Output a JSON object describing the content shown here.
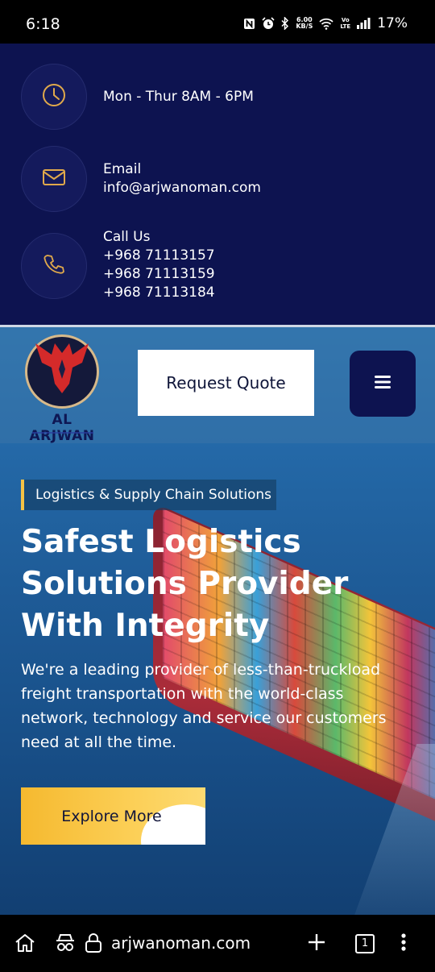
{
  "status_bar": {
    "time": "6:18",
    "network_speed_value": "6.00",
    "network_speed_unit": "KB/S",
    "volte_top": "Vo",
    "volte_bottom": "LTE",
    "battery": "17%",
    "icons": [
      "nfc-icon",
      "alarm-icon",
      "bluetooth-icon",
      "wifi-icon",
      "signal-icon"
    ]
  },
  "contact_info": {
    "hours": {
      "icon": "clock-icon",
      "text": "Mon - Thur 8AM - 6PM"
    },
    "email": {
      "icon": "mail-icon",
      "label": "Email",
      "value": "info@arjwanoman.com"
    },
    "phone": {
      "icon": "phone-icon",
      "label": "Call Us",
      "numbers": [
        "+968 71113157",
        "+968 71113159",
        "+968 71113184"
      ]
    }
  },
  "header": {
    "logo_name": "AL ARJWAN",
    "request_quote_label": "Request Quote",
    "menu_icon": "hamburger-icon"
  },
  "hero": {
    "tag": "Logistics & Supply Chain Solutions",
    "headline_lines": [
      "Safest Logistics",
      "Solutions Provider",
      "With Integrity"
    ],
    "description_lines": [
      "We're a leading provider of less-than-truckload",
      "freight transportation with the world-class",
      "network, technology and service our customers",
      "need at all the time."
    ],
    "cta_label": "Explore More"
  },
  "browser": {
    "url": "arjwanoman.com",
    "tab_count": "1",
    "icons": [
      "home-icon",
      "incognito-icon",
      "lock-icon",
      "plus-icon",
      "tabs-icon",
      "more-icon"
    ]
  },
  "colors": {
    "navy": "#0d1350",
    "accent_gold": "#f5c245",
    "icon_gold": "#e0a94b"
  }
}
